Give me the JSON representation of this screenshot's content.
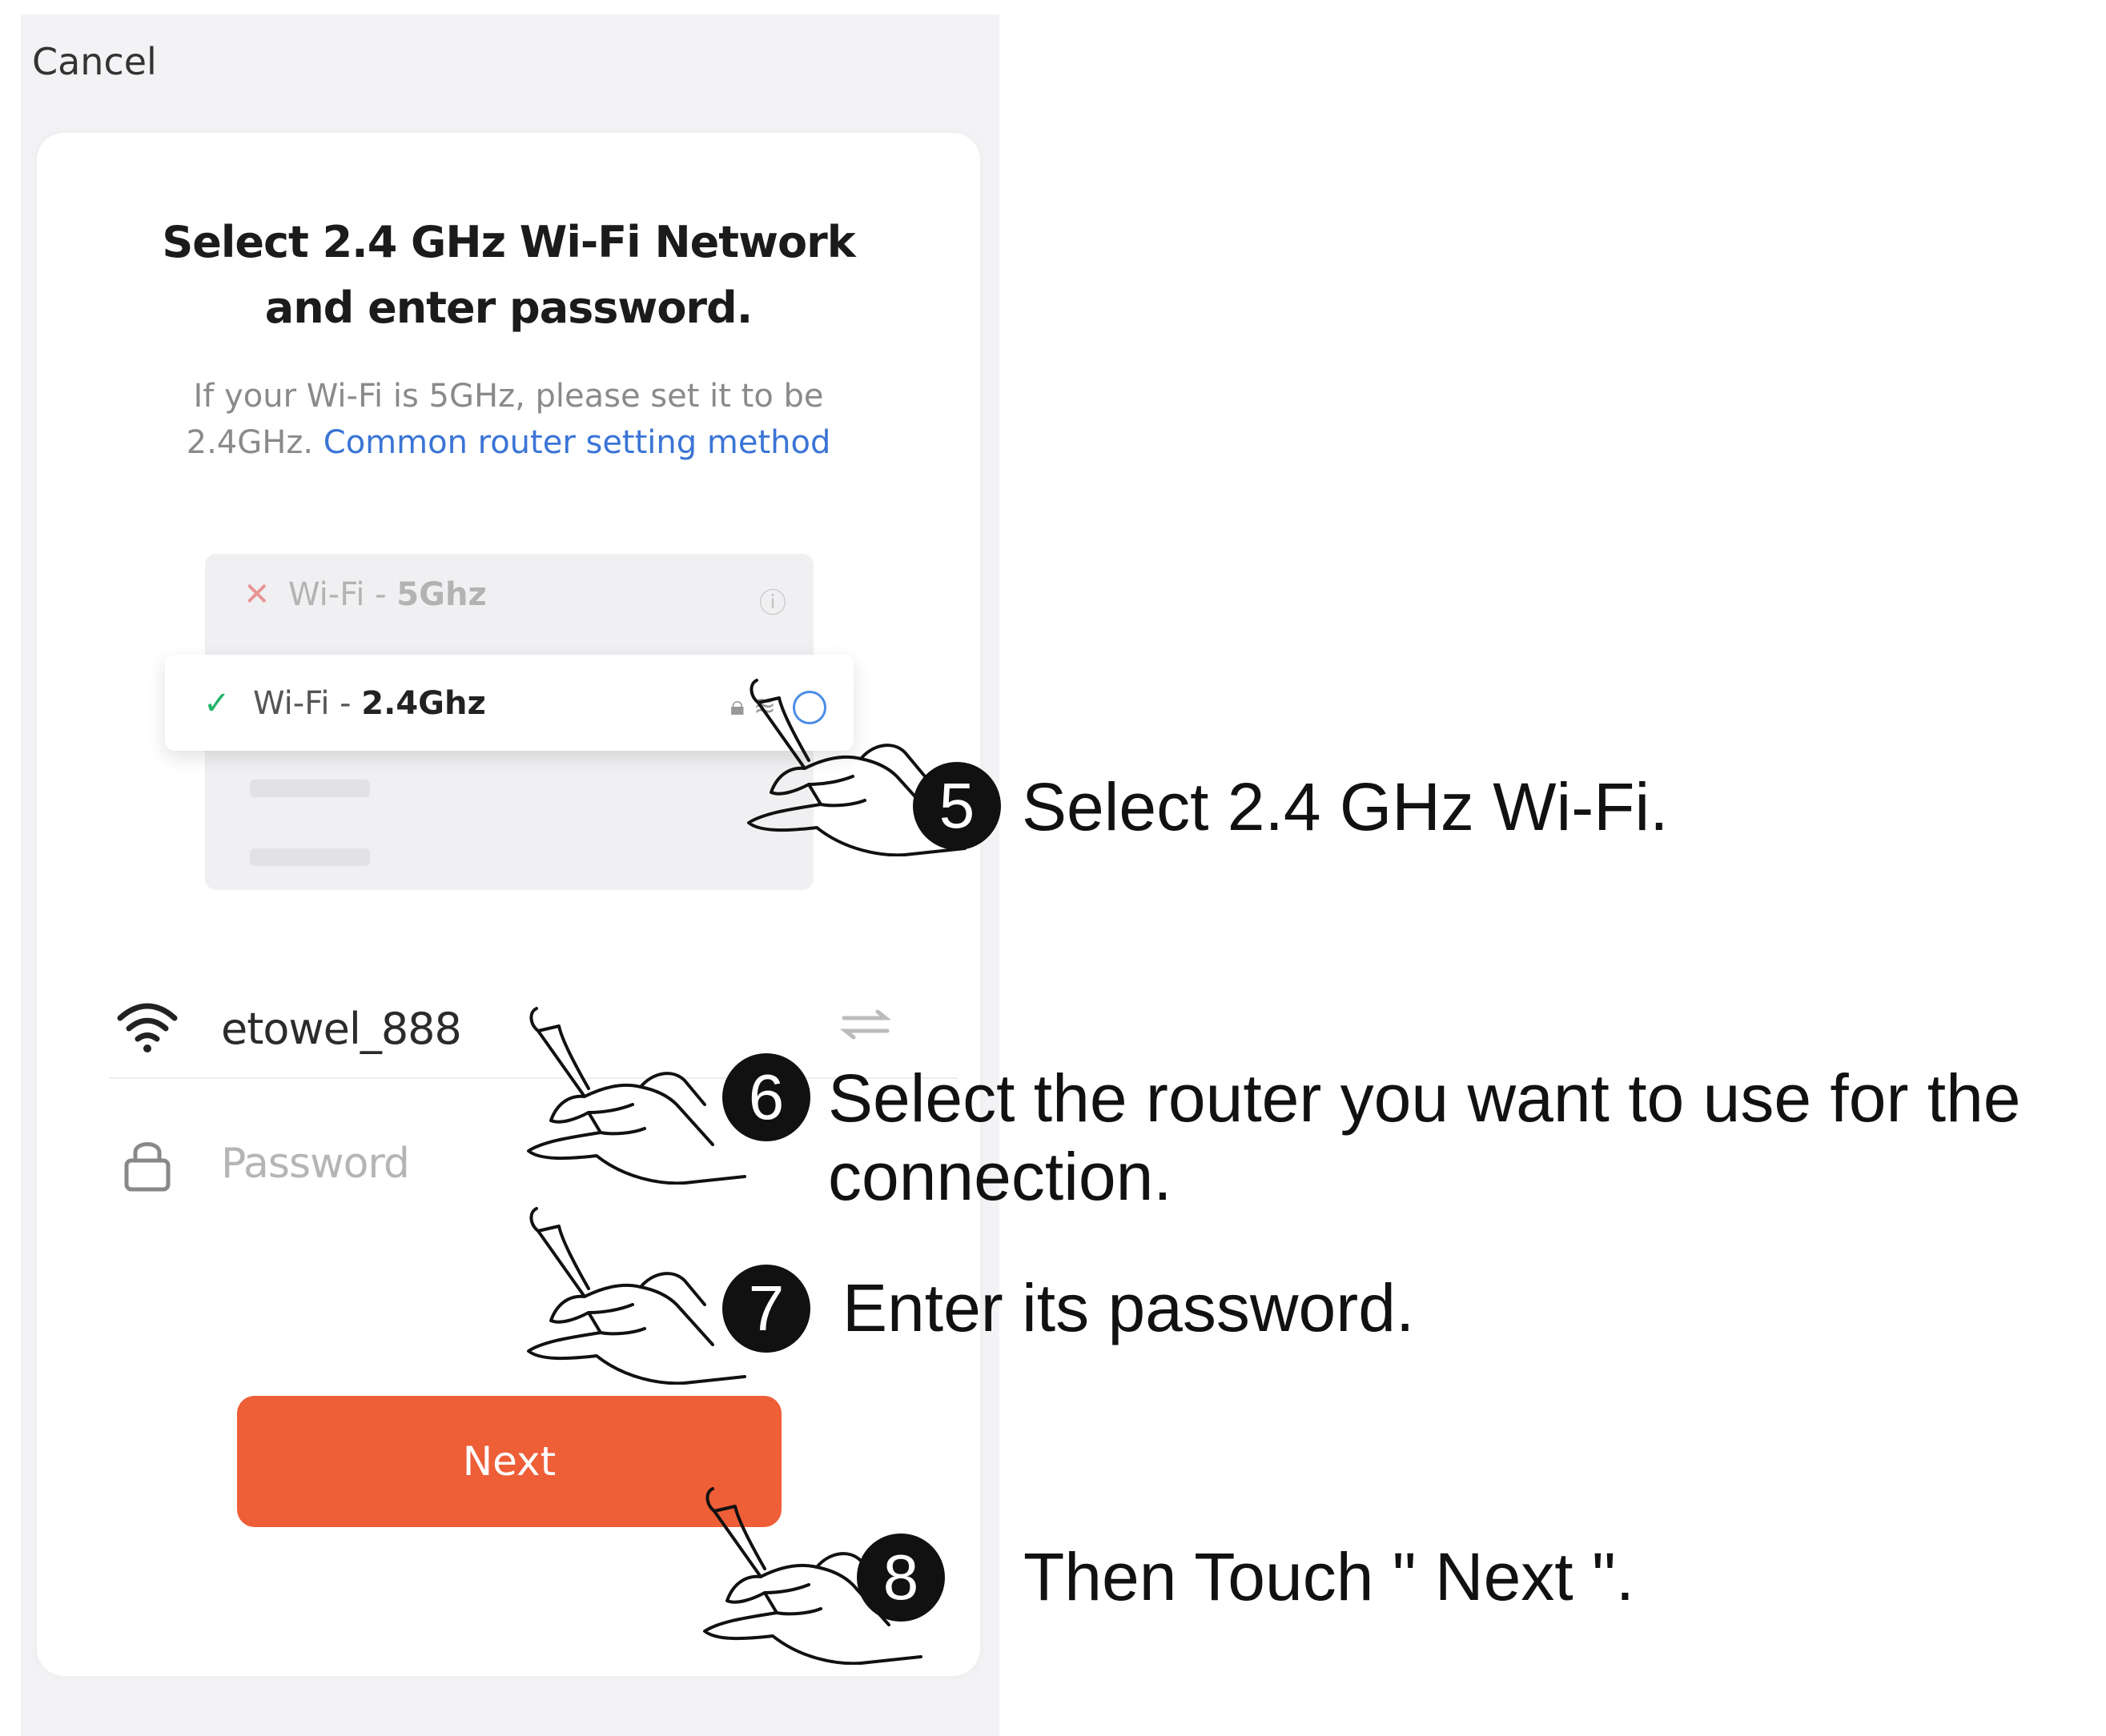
{
  "phone": {
    "cancel_label": "Cancel",
    "title_line1": "Select 2.4 GHz Wi-Fi Network",
    "title_line2": "and enter password.",
    "subtitle_line1": "If your Wi-Fi is 5GHz, please set it to be",
    "subtitle_line2_prefix": "2.4GHz.",
    "subtitle_link": "Common router setting method",
    "wifi_list": [
      {
        "name_prefix": "Wi-Fi - ",
        "name_band": "5Ghz",
        "status": "unsupported",
        "status_icon": "x-icon"
      },
      {
        "name_prefix": "Wi-Fi - ",
        "name_band": "2.4Ghz",
        "status": "supported",
        "status_icon": "check-icon"
      }
    ],
    "network_value": "etowel_888",
    "password_placeholder": "Password",
    "next_label": "Next",
    "colors": {
      "accent": "#ee5e37",
      "link": "#3a74d6",
      "check": "#22b36a",
      "cross": "#e23b3b"
    }
  },
  "steps": [
    {
      "number": "5",
      "text": "Select 2.4 GHz Wi-Fi."
    },
    {
      "number": "6",
      "text_line1": "Select the router you want to use for the",
      "text_line2": "connection."
    },
    {
      "number": "7",
      "text": "Enter its password."
    },
    {
      "number": "8",
      "text": "Then Touch \" Next \"."
    }
  ]
}
